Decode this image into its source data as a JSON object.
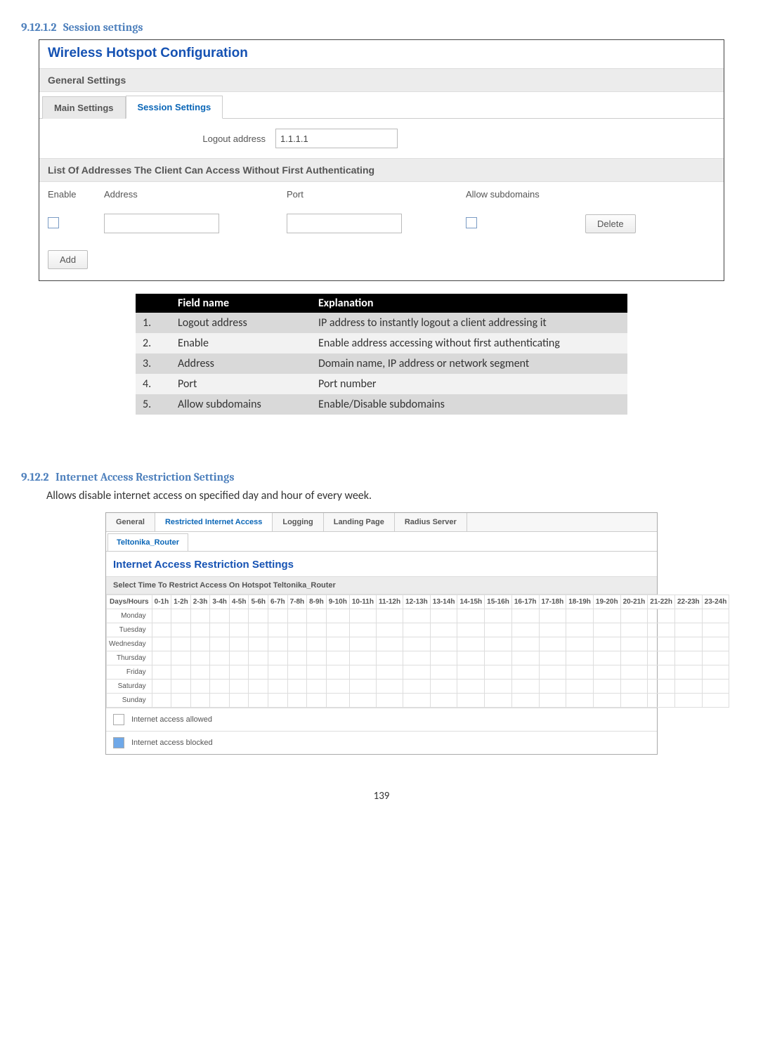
{
  "section1": {
    "number": "9.12.1.2",
    "title": "Session settings"
  },
  "fig1": {
    "title": "Wireless Hotspot Configuration",
    "general_settings": "General Settings",
    "tabs": {
      "main": "Main Settings",
      "session": "Session Settings"
    },
    "logout_label": "Logout address",
    "logout_value": "1.1.1.1",
    "list_heading": "List Of Addresses The Client Can Access Without First Authenticating",
    "cols": {
      "enable": "Enable",
      "address": "Address",
      "port": "Port",
      "allow": "Allow subdomains"
    },
    "delete": "Delete",
    "add": "Add"
  },
  "def_table": {
    "head_field": "Field name",
    "head_expl": "Explanation",
    "rows": [
      {
        "n": "1.",
        "field": "Logout address",
        "expl": "IP address to instantly logout a client addressing it"
      },
      {
        "n": "2.",
        "field": "Enable",
        "expl": "Enable address accessing without first authenticating"
      },
      {
        "n": "3.",
        "field": "Address",
        "expl": "Domain name, IP address or network segment"
      },
      {
        "n": "4.",
        "field": "Port",
        "expl": "Port number"
      },
      {
        "n": "5.",
        "field": "Allow subdomains",
        "expl": "Enable/Disable subdomains"
      }
    ]
  },
  "section2": {
    "number": "9.12.2",
    "title": "Internet Access Restriction Settings",
    "desc": "Allows disable internet access on specified day and hour of every week."
  },
  "fig2": {
    "tabs": {
      "general": "General",
      "restricted": "Restricted Internet Access",
      "logging": "Logging",
      "landing": "Landing Page",
      "radius": "Radius Server"
    },
    "subtab": "Teltonika_Router",
    "title": "Internet Access Restriction Settings",
    "select_time": "Select Time To Restrict Access On Hotspot Teltonika_Router",
    "days_hours": "Days/Hours",
    "hours": [
      "0-1h",
      "1-2h",
      "2-3h",
      "3-4h",
      "4-5h",
      "5-6h",
      "6-7h",
      "7-8h",
      "8-9h",
      "9-10h",
      "10-11h",
      "11-12h",
      "12-13h",
      "13-14h",
      "14-15h",
      "15-16h",
      "16-17h",
      "17-18h",
      "18-19h",
      "19-20h",
      "20-21h",
      "21-22h",
      "22-23h",
      "23-24h"
    ],
    "days": [
      "Monday",
      "Tuesday",
      "Wednesday",
      "Thursday",
      "Friday",
      "Saturday",
      "Sunday"
    ],
    "legend": {
      "allowed": "Internet access allowed",
      "blocked": "Internet access blocked"
    }
  },
  "page_number": "139"
}
